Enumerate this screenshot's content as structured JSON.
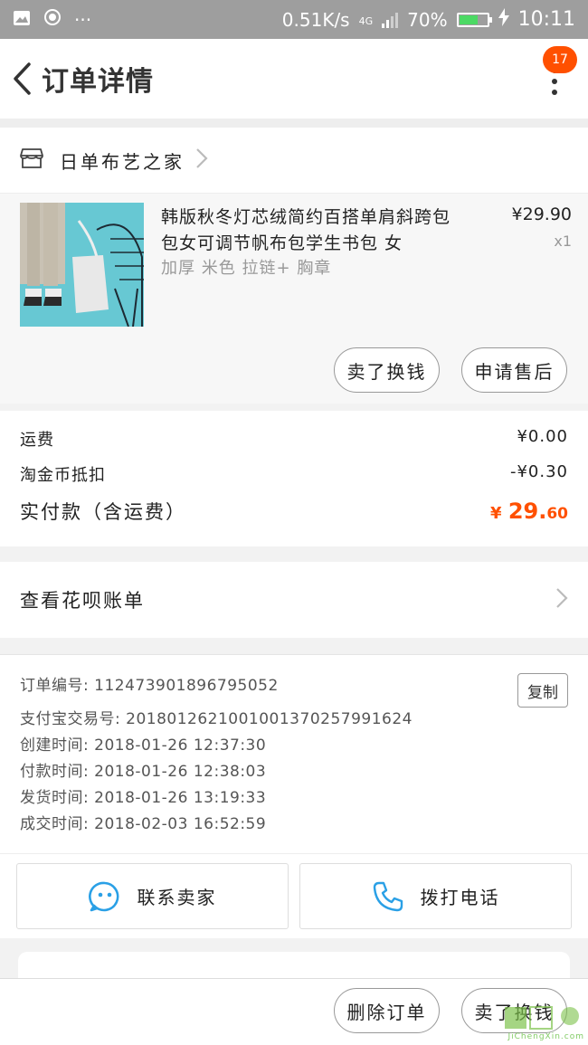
{
  "status_bar": {
    "net_speed": "0.51K/s",
    "net_type": "4G",
    "battery": "70%",
    "battery_level": 0.7,
    "time": "10:11"
  },
  "header": {
    "title": "订单详情",
    "badge": "17"
  },
  "shop": {
    "name": "日单布艺之家"
  },
  "item": {
    "title": "韩版秋冬灯芯绒简约百搭单肩斜跨包包女可调节帆布包学生书包 女",
    "sku": "加厚 米色 拉链+ 胸章",
    "price": "¥29.90",
    "qty": "x1",
    "sell_label": "卖了换钱",
    "after_sale_label": "申请售后"
  },
  "fees": {
    "shipping_label": "运费",
    "shipping_value": "¥0.00",
    "coin_label": "淘金币抵扣",
    "coin_value": "-¥0.30",
    "paid_label": "实付款（含运费）",
    "paid_yen": "¥",
    "paid_int": "29.",
    "paid_dec": "60"
  },
  "huabei": {
    "label": "查看花呗账单"
  },
  "order_info": {
    "order_no": "订单编号: 112473901896795052",
    "alipay_no": "支付宝交易号: 2018012621001001370257991624",
    "created": "创建时间: 2018-01-26 12:37:30",
    "paid": "付款时间: 2018-01-26 12:38:03",
    "shipped": "发货时间: 2018-01-26 13:19:33",
    "completed": "成交时间: 2018-02-03 16:52:59",
    "copy_label": "复制"
  },
  "contact": {
    "seller_label": "联系卖家",
    "phone_label": "拨打电话"
  },
  "bottom": {
    "delete_label": "删除订单",
    "sell_label": "卖了换钱"
  },
  "watermark": {
    "text": "JiChengXin.com"
  },
  "colors": {
    "accent": "#ff5000",
    "icon_blue": "#2aa0e6",
    "statusbar": "#9e9e9e"
  }
}
